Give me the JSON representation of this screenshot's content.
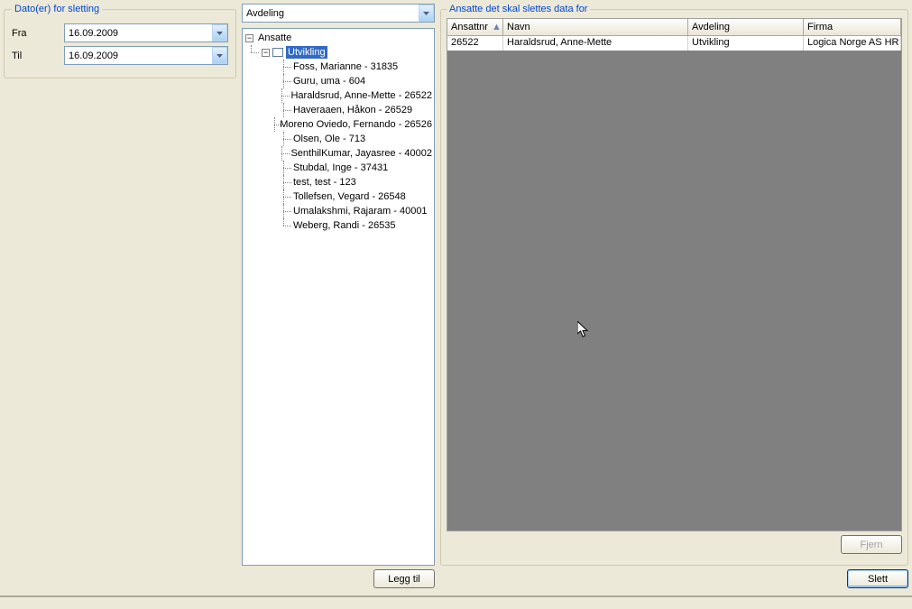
{
  "dates_group": {
    "legend": "Dato(er) for sletting",
    "fra_label": "Fra",
    "til_label": "Til",
    "fra_value": "16.09.2009",
    "til_value": "16.09.2009"
  },
  "combo": {
    "value": "Avdeling"
  },
  "tree": {
    "root": "Ansatte",
    "selected": "Utvikling",
    "employees": [
      "Foss, Marianne - 31835",
      "Guru, uma - 604",
      "Haraldsrud, Anne-Mette - 26522",
      "Haveraaen, Håkon - 26529",
      "Moreno Oviedo, Fernando - 26526",
      "Olsen, Ole - 713",
      "SenthilKumar, Jayasree - 40002",
      "Stubdal, Inge - 37431",
      "test, test - 123",
      "Tollefsen, Vegard - 26548",
      "Umalakshmi, Rajaram - 40001",
      "Weberg, Randi - 26535"
    ]
  },
  "buttons": {
    "legg_til": "Legg til",
    "fjern": "Fjern",
    "slett": "Slett"
  },
  "grid": {
    "legend": "Ansatte det skal slettes data for",
    "headers": {
      "ansattnr": "Ansattnr",
      "navn": "Navn",
      "avdeling": "Avdeling",
      "firma": "Firma"
    },
    "rows": [
      {
        "ansattnr": "26522",
        "navn": "Haraldsrud, Anne-Mette",
        "avdeling": "Utvikling",
        "firma": "Logica Norge AS HR"
      }
    ]
  }
}
